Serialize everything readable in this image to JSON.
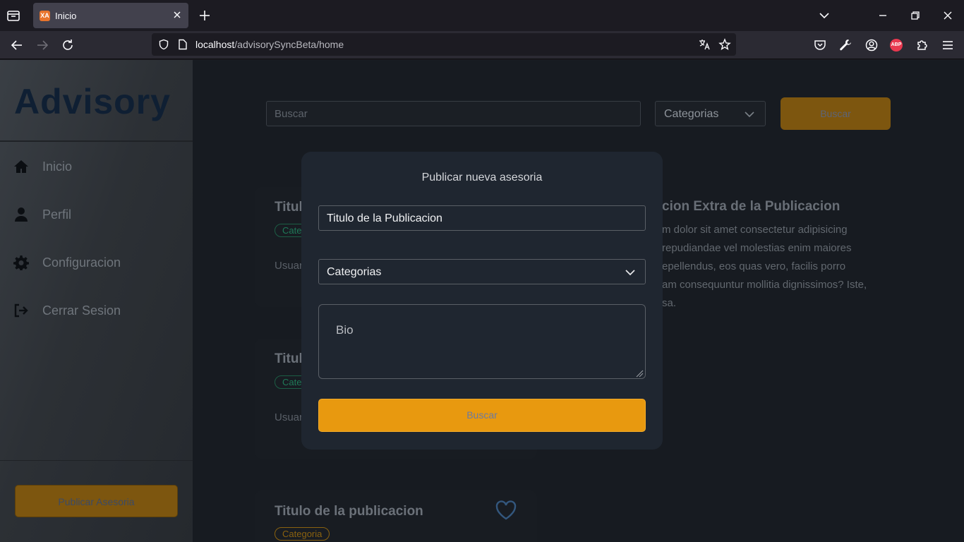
{
  "browser": {
    "tab_title": "Inicio",
    "tab_favicon_text": "XA",
    "url_host": "localhost",
    "url_path": "/advisorySyncBeta/home",
    "abp_label": "ABP"
  },
  "sidebar": {
    "brand": "Advisory",
    "items": [
      {
        "label": "Inicio",
        "icon": "home-icon"
      },
      {
        "label": "Perfil",
        "icon": "user-icon"
      },
      {
        "label": "Configuracion",
        "icon": "gear-icon"
      },
      {
        "label": "Cerrar Sesion",
        "icon": "logout-icon"
      }
    ],
    "publish_label": "Publicar Asesoria"
  },
  "toolbar": {
    "search_placeholder": "Buscar",
    "category_label": "Categorias",
    "search_button": "Buscar"
  },
  "cards": [
    {
      "title": "Titul",
      "badge": "Cate",
      "user": "Usuar"
    },
    {
      "title": "Titul",
      "badge": "Cate",
      "user": "Usuar"
    },
    {
      "title": "Titulo de la publicacion",
      "badge": "Categoria"
    }
  ],
  "info": {
    "title": "cion Extra de la Publicacion",
    "lines": [
      "m dolor sit amet consectetur adipisicing",
      "repudiandae vel molestias enim maiores",
      "epellendus, eos quas vero, facilis porro",
      "am consequuntur mollitia dignissimos? Iste,",
      "sa."
    ]
  },
  "modal": {
    "title": "Publicar nueva asesoria",
    "title_value": "Titulo de la Publicacion",
    "category": "Categorias",
    "bio_placeholder": "Bio",
    "submit_label": "Buscar"
  },
  "colors": {
    "accent": "#e8990f",
    "modal_bg": "#1f2630",
    "badge_green": "#1f7a58"
  }
}
